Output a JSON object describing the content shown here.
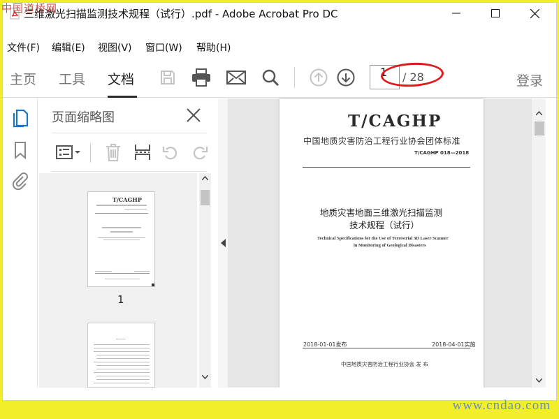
{
  "watermark": {
    "top": "中国道桥网",
    "bottom": "www.cndao.com"
  },
  "window": {
    "title": "三维激光扫描监测技术规程（试行）.pdf - Adobe Acrobat Pro DC"
  },
  "menu": [
    "文件(F)",
    "编辑(E)",
    "视图(V)",
    "窗口(W)",
    "帮助(H)"
  ],
  "toolbar": {
    "tabs": [
      "主页",
      "工具",
      "文档"
    ],
    "active_tab": "文档",
    "current_page": "1",
    "total_pages": "/ 28",
    "login": "登录"
  },
  "panel": {
    "title": "页面缩略图",
    "thumbnail_label": "1"
  },
  "document": {
    "standard": "T/CAGHP",
    "organization_header": "中国地质灾害防治工程行业协会团体标准",
    "code": "T/CAGHP 018—2018",
    "title_zh_line1": "地质灾害地面三维激光扫描监测",
    "title_zh_line2": "技术规程（试行）",
    "title_en_line1": "Technical Specifications for the Use of Terrestrial 3D Laser Scanner",
    "title_en_line2": "in Monitoring of Geological Disasters",
    "issue_date": "2018-01-01发布",
    "implement_date": "2018-04-01实施",
    "publisher": "中国地质灾害防治工程行业协会    发  布"
  },
  "colors": {
    "accent": "#1a73c8",
    "highlight": "#e01b1b",
    "frame": "#f2ee2a"
  }
}
